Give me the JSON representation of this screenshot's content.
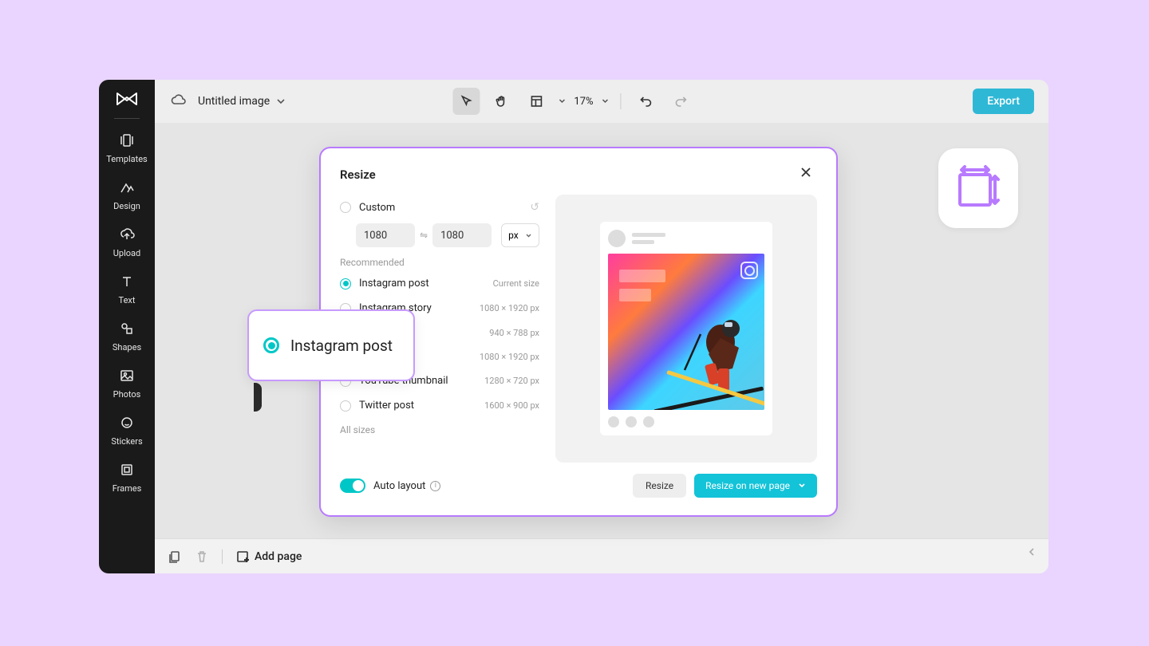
{
  "header": {
    "title": "Untitled image",
    "zoom": "17%",
    "export": "Export"
  },
  "sidebar": {
    "items": [
      {
        "label": "Templates"
      },
      {
        "label": "Design"
      },
      {
        "label": "Upload"
      },
      {
        "label": "Text"
      },
      {
        "label": "Shapes"
      },
      {
        "label": "Photos"
      },
      {
        "label": "Stickers"
      },
      {
        "label": "Frames"
      }
    ]
  },
  "bottombar": {
    "add_page": "Add page"
  },
  "modal": {
    "title": "Resize",
    "custom_label": "Custom",
    "width": "1080",
    "height": "1080",
    "unit": "px",
    "recommended_label": "Recommended",
    "options": [
      {
        "label": "Instagram post",
        "meta": "Current size",
        "selected": true
      },
      {
        "label": "Instagram story",
        "meta": "1080 × 1920 px",
        "selected": false
      },
      {
        "label": "",
        "meta": "940 × 788 px",
        "selected": false
      },
      {
        "label": "",
        "meta": "1080 × 1920 px",
        "selected": false
      },
      {
        "label": "YouTube thumbnail",
        "meta": "1280 × 720 px",
        "selected": false
      },
      {
        "label": "Twitter post",
        "meta": "1600 × 900 px",
        "selected": false
      }
    ],
    "all_sizes_label": "All sizes",
    "auto_layout": "Auto layout",
    "resize_btn": "Resize",
    "resize_new_btn": "Resize on new page"
  },
  "callout": {
    "text": "Instagram post"
  }
}
